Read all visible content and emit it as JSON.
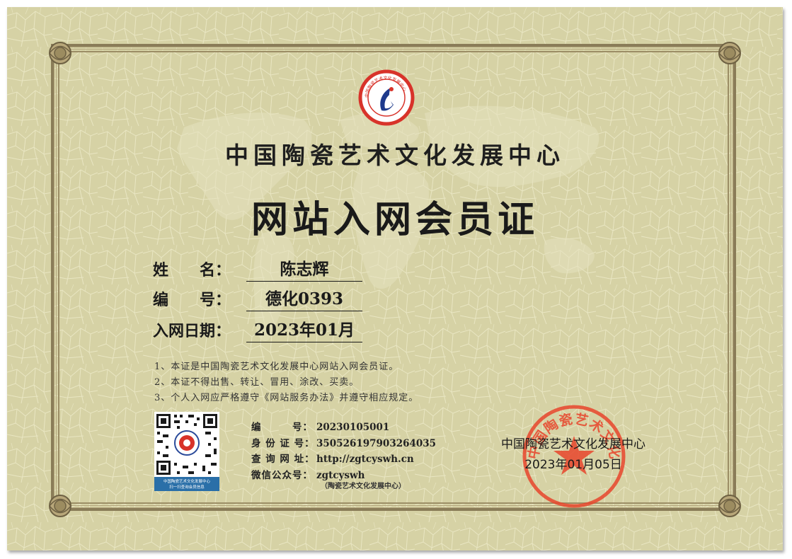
{
  "certificate": {
    "organization": "中国陶瓷艺术文化发展中心",
    "title": "网站入网会员证",
    "fields": [
      {
        "label": "姓　　名：",
        "value": "陈志辉"
      },
      {
        "label": "编　　号：",
        "value": "德化0393"
      },
      {
        "label": "入网日期：",
        "value": "2023年01月"
      }
    ],
    "notes": [
      "1、本证是中国陶瓷艺术文化发展中心网站入网会员证。",
      "2、本证不得出售、转让、冒用、涂改、买卖。",
      "3、个人入网应严格遵守《网站服务办法》并遵守相应规定。"
    ],
    "info": [
      {
        "label": "编　　　号：",
        "value": "20230105001"
      },
      {
        "label": "身 份 证 号：",
        "value": "350526197903264035"
      },
      {
        "label": "查 询 网 址：",
        "value": "http://zgtcyswh.cn"
      },
      {
        "label": "微信公众号：",
        "value": "zgtcyswh"
      }
    ],
    "info_sub": "（陶瓷艺术文化发展中心）",
    "issuer": "中国陶瓷艺术文化发展中心",
    "issue_date": "2023年01月05日",
    "logo_text": "中国陶瓷艺术文化发展中心",
    "seal_text": "中国陶瓷艺术文化发展中心",
    "qr_caption_1": "中国陶瓷艺术文化发展中心",
    "qr_caption_2": "扫一扫查询会员信息"
  },
  "colors": {
    "paper": "#d6d2a5",
    "frame": "#8a7c58",
    "seal_red": "#e8452c",
    "logo_red": "#d8332a",
    "logo_blue": "#1e3a8c"
  },
  "icons": {
    "logo": "ceramics-center-emblem",
    "seal": "red-star-seal",
    "qr": "qr-code"
  }
}
